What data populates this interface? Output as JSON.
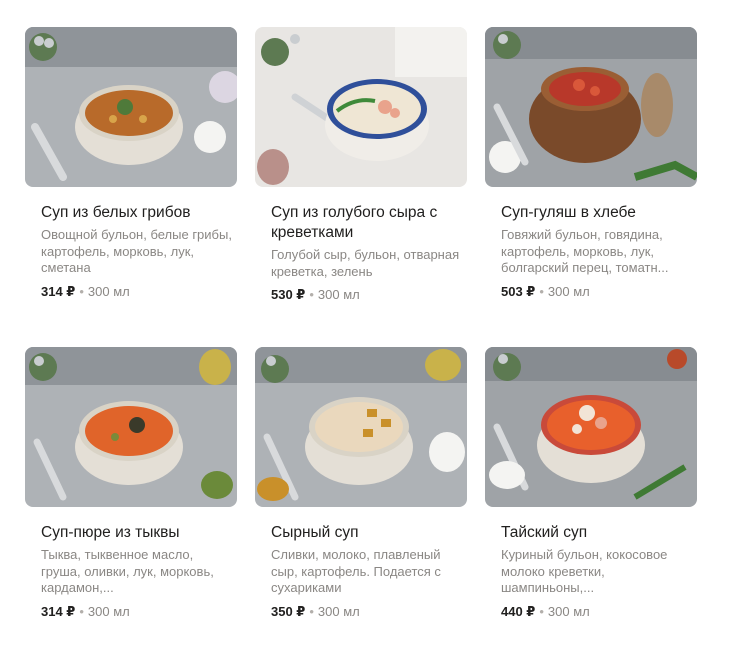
{
  "items": [
    {
      "name": "Суп из белых грибов",
      "description": "Овощной бульон, белые грибы, картофель, морковь, лук, сметана",
      "price": "314 ₽",
      "separator": "•",
      "weight": "300 мл",
      "soup_color": "#b86a2a",
      "bowl_rim": "#d9d3c6",
      "photo_icon": "mushroom-soup-photo"
    },
    {
      "name": "Суп из голубого сыра с креветками",
      "description": "Голубой сыр, бульон, отварная креветка, зелень",
      "price": "530 ₽",
      "separator": "•",
      "weight": "300 мл",
      "soup_color": "#efe6d4",
      "bowl_rim": "#2f4f9a",
      "photo_icon": "blue-cheese-soup-photo"
    },
    {
      "name": "Суп-гуляш в хлебе",
      "description": "Говяжий бульон, говядина, картофель, морковь, лук, болгарский перец, томатн...",
      "price": "503 ₽",
      "separator": "•",
      "weight": "300 мл",
      "soup_color": "#b8382a",
      "bowl_rim": "#7a4a2a",
      "photo_icon": "goulash-bread-photo"
    },
    {
      "name": "Суп-пюре из тыквы",
      "description": "Тыква, тыквенное масло, груша, оливки, лук, морковь, кардамон,...",
      "price": "314 ₽",
      "separator": "•",
      "weight": "300 мл",
      "soup_color": "#e0642a",
      "bowl_rim": "#d9d3c6",
      "photo_icon": "pumpkin-soup-photo"
    },
    {
      "name": "Сырный суп",
      "description": "Сливки, молоко, плавленый сыр, картофель. Подается с сухариками",
      "price": "350 ₽",
      "separator": "•",
      "weight": "300 мл",
      "soup_color": "#ead8bd",
      "bowl_rim": "#d9d3c6",
      "photo_icon": "cheese-soup-photo"
    },
    {
      "name": "Тайский суп",
      "description": "Куриный бульон, кокосовое молоко креветки, шампиньоны,...",
      "price": "440 ₽",
      "separator": "•",
      "weight": "300 мл",
      "soup_color": "#e8602c",
      "bowl_rim": "#c94a3a",
      "photo_icon": "thai-soup-photo"
    }
  ]
}
